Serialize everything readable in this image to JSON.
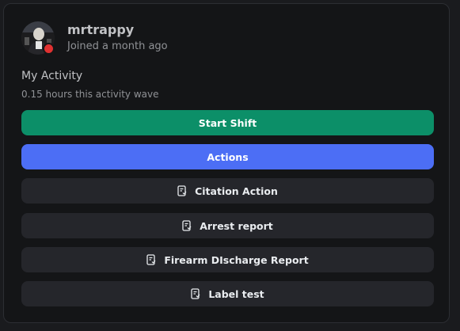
{
  "profile": {
    "username": "mrtrappy",
    "joined": "Joined a month ago",
    "status_color": "#e03131"
  },
  "activity": {
    "title": "My Activity",
    "summary": "0.15 hours this activity wave"
  },
  "buttons": {
    "start_shift": {
      "label": "Start Shift",
      "color": "#0c8f68"
    },
    "actions": {
      "label": "Actions",
      "color": "#4c6ef5"
    },
    "reports": [
      {
        "label": "Citation Action",
        "icon": "report-icon"
      },
      {
        "label": "Arrest report",
        "icon": "report-icon"
      },
      {
        "label": "Firearm DIscharge Report",
        "icon": "report-icon"
      },
      {
        "label": "Label test",
        "icon": "report-icon"
      }
    ]
  }
}
